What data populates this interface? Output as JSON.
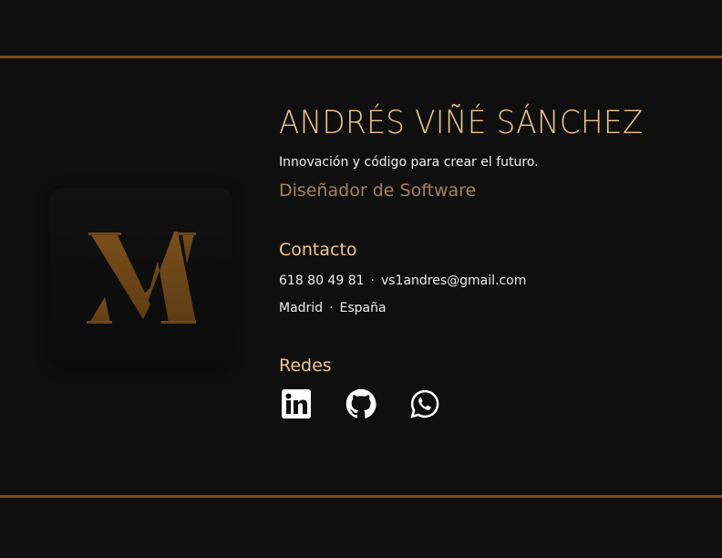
{
  "profile": {
    "name": "ANDRÉS VIÑÉ SÁNCHEZ",
    "tagline": "Innovación y código para crear el futuro.",
    "role": "Diseñador de Software",
    "logo_letters": "AV"
  },
  "contact": {
    "heading": "Contacto",
    "phone": "618 80 49 81",
    "email": "vs1andres@gmail.com",
    "city": "Madrid",
    "country": "España",
    "separator": "·"
  },
  "social": {
    "heading": "Redes",
    "icons": [
      "linkedin-icon",
      "github-icon",
      "whatsapp-icon"
    ]
  },
  "colors": {
    "accent": "#f0c58e",
    "rule": "#7a4d1c",
    "background": "#0f0f0f",
    "role": "#a98157"
  }
}
